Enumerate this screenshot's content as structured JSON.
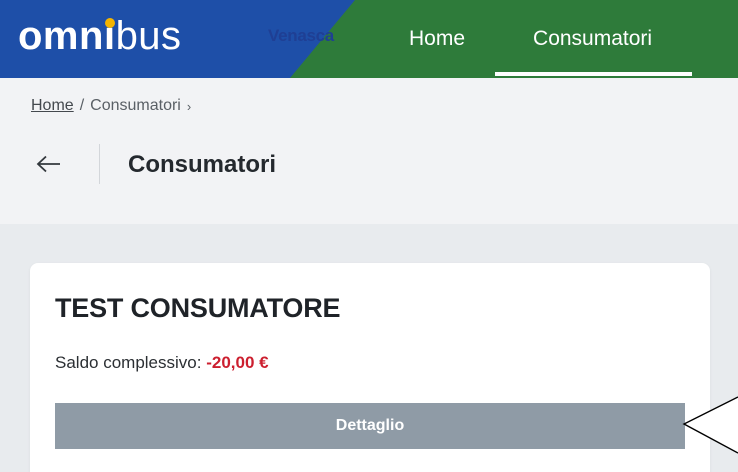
{
  "header": {
    "logo": {
      "part1": "omn",
      "part2": "i",
      "part3": "bus"
    },
    "agency": "Venasca",
    "nav": [
      {
        "label": "Home",
        "active": false
      },
      {
        "label": "Consumatori",
        "active": true
      }
    ],
    "colors": {
      "blue": "#1e4fa8",
      "green": "#2e7b3a",
      "accent_dot": "#f4b400"
    }
  },
  "breadcrumb": {
    "items": [
      "Home",
      "Consumatori"
    ],
    "separator": "/",
    "trailing": "›"
  },
  "page": {
    "back_icon": "arrow-left-icon",
    "title": "Consumatori"
  },
  "card": {
    "name": "TEST CONSUMATORE",
    "balance_label": "Saldo complessivo:",
    "balance_value": "-20,00 €",
    "button_label": "Dettaglio"
  }
}
